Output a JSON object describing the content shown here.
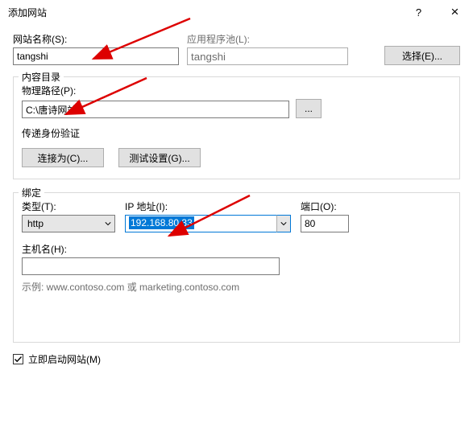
{
  "window": {
    "title": "添加网站",
    "help": "?",
    "close": "×"
  },
  "siteName": {
    "label": "网站名称(S):",
    "value": "tangshi"
  },
  "appPool": {
    "label": "应用程序池(L):",
    "value": "tangshi"
  },
  "selectBtn": "选择(E)...",
  "contentGroup": "内容目录",
  "physPath": {
    "label": "物理路径(P):",
    "value": "C:\\唐诗网站"
  },
  "browseBtn": "...",
  "passAuth": "传递身份验证",
  "connectAsBtn": "连接为(C)...",
  "testBtn": "测试设置(G)...",
  "bindGroup": "绑定",
  "type": {
    "label": "类型(T):",
    "value": "http"
  },
  "ip": {
    "label": "IP 地址(I):",
    "value": "192.168.80.33"
  },
  "port": {
    "label": "端口(O):",
    "value": "80"
  },
  "hostName": {
    "label": "主机名(H):",
    "value": ""
  },
  "example": "示例: www.contoso.com 或 marketing.contoso.com",
  "startNow": "立即启动网站(M)"
}
